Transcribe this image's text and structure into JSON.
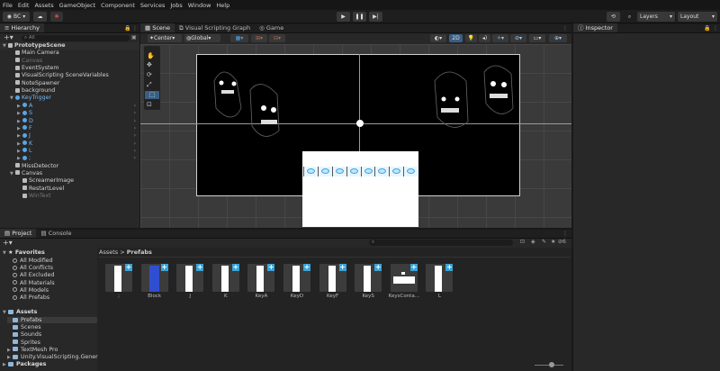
{
  "menu": [
    "File",
    "Edit",
    "Assets",
    "GameObject",
    "Component",
    "Services",
    "Jobs",
    "Window",
    "Help"
  ],
  "toolbar": {
    "account": "BC",
    "layers": "Layers",
    "layout": "Layout"
  },
  "hierarchy": {
    "tab": "Hierarchy",
    "search": "All",
    "rows": [
      {
        "label": "PrototypeScene",
        "indent": 0,
        "type": "scene",
        "bold": true
      },
      {
        "label": "Main Camera",
        "indent": 1,
        "type": "obj"
      },
      {
        "label": "Canvas",
        "indent": 1,
        "type": "dim"
      },
      {
        "label": "EventSystem",
        "indent": 1,
        "type": "obj"
      },
      {
        "label": "VisualScripting SceneVariables",
        "indent": 1,
        "type": "obj"
      },
      {
        "label": "NoteSpawner",
        "indent": 1,
        "type": "obj"
      },
      {
        "label": "background",
        "indent": 1,
        "type": "obj"
      },
      {
        "label": "KeyTrigger",
        "indent": 1,
        "type": "blue",
        "expand": true
      },
      {
        "label": "A",
        "indent": 2,
        "type": "blue",
        "chev": true
      },
      {
        "label": "S",
        "indent": 2,
        "type": "blue",
        "chev": true
      },
      {
        "label": "D",
        "indent": 2,
        "type": "blue",
        "chev": true
      },
      {
        "label": "F",
        "indent": 2,
        "type": "blue",
        "chev": true
      },
      {
        "label": "J",
        "indent": 2,
        "type": "blue",
        "chev": true
      },
      {
        "label": "K",
        "indent": 2,
        "type": "blue",
        "chev": true
      },
      {
        "label": "L",
        "indent": 2,
        "type": "blue",
        "chev": true
      },
      {
        "label": ";",
        "indent": 2,
        "type": "blue",
        "chev": true
      },
      {
        "label": "MissDetector",
        "indent": 1,
        "type": "obj"
      },
      {
        "label": "Canvas",
        "indent": 1,
        "type": "obj",
        "expand": true
      },
      {
        "label": "ScreamerImage",
        "indent": 2,
        "type": "obj"
      },
      {
        "label": "RestartLevel",
        "indent": 2,
        "type": "obj"
      },
      {
        "label": "WinText",
        "indent": 2,
        "type": "dim"
      }
    ]
  },
  "scene": {
    "tabs": [
      "Scene",
      "Visual Scripting Graph",
      "Game"
    ],
    "pivot": "Center",
    "space": "Global",
    "mode2d": "2D"
  },
  "inspector": {
    "tab": "Inspector"
  },
  "project": {
    "tabs": [
      "Project",
      "Console"
    ],
    "favorites_title": "Favorites",
    "favorites": [
      "All Modified",
      "All Conflicts",
      "All Excluded",
      "All Materials",
      "All Models",
      "All Prefabs"
    ],
    "assets_title": "Assets",
    "assets_folders": [
      "Prefabs",
      "Scenes",
      "Sounds",
      "Sprites",
      "TextMesh Pro",
      "Unity.VisualScripting.Gener"
    ],
    "packages_title": "Packages",
    "breadcrumb_root": "Assets",
    "breadcrumb_sep": ">",
    "breadcrumb_current": "Prefabs",
    "badge_count": "6",
    "items": [
      {
        "label": ";",
        "kind": "white"
      },
      {
        "label": "Block",
        "kind": "blue"
      },
      {
        "label": "J",
        "kind": "white"
      },
      {
        "label": "K",
        "kind": "white"
      },
      {
        "label": "KeyA",
        "kind": "white"
      },
      {
        "label": "KeyD",
        "kind": "white"
      },
      {
        "label": "KeyF",
        "kind": "white"
      },
      {
        "label": "KeyS",
        "kind": "white"
      },
      {
        "label": "KeysConta...",
        "kind": "container"
      },
      {
        "label": "L",
        "kind": "white"
      }
    ]
  }
}
